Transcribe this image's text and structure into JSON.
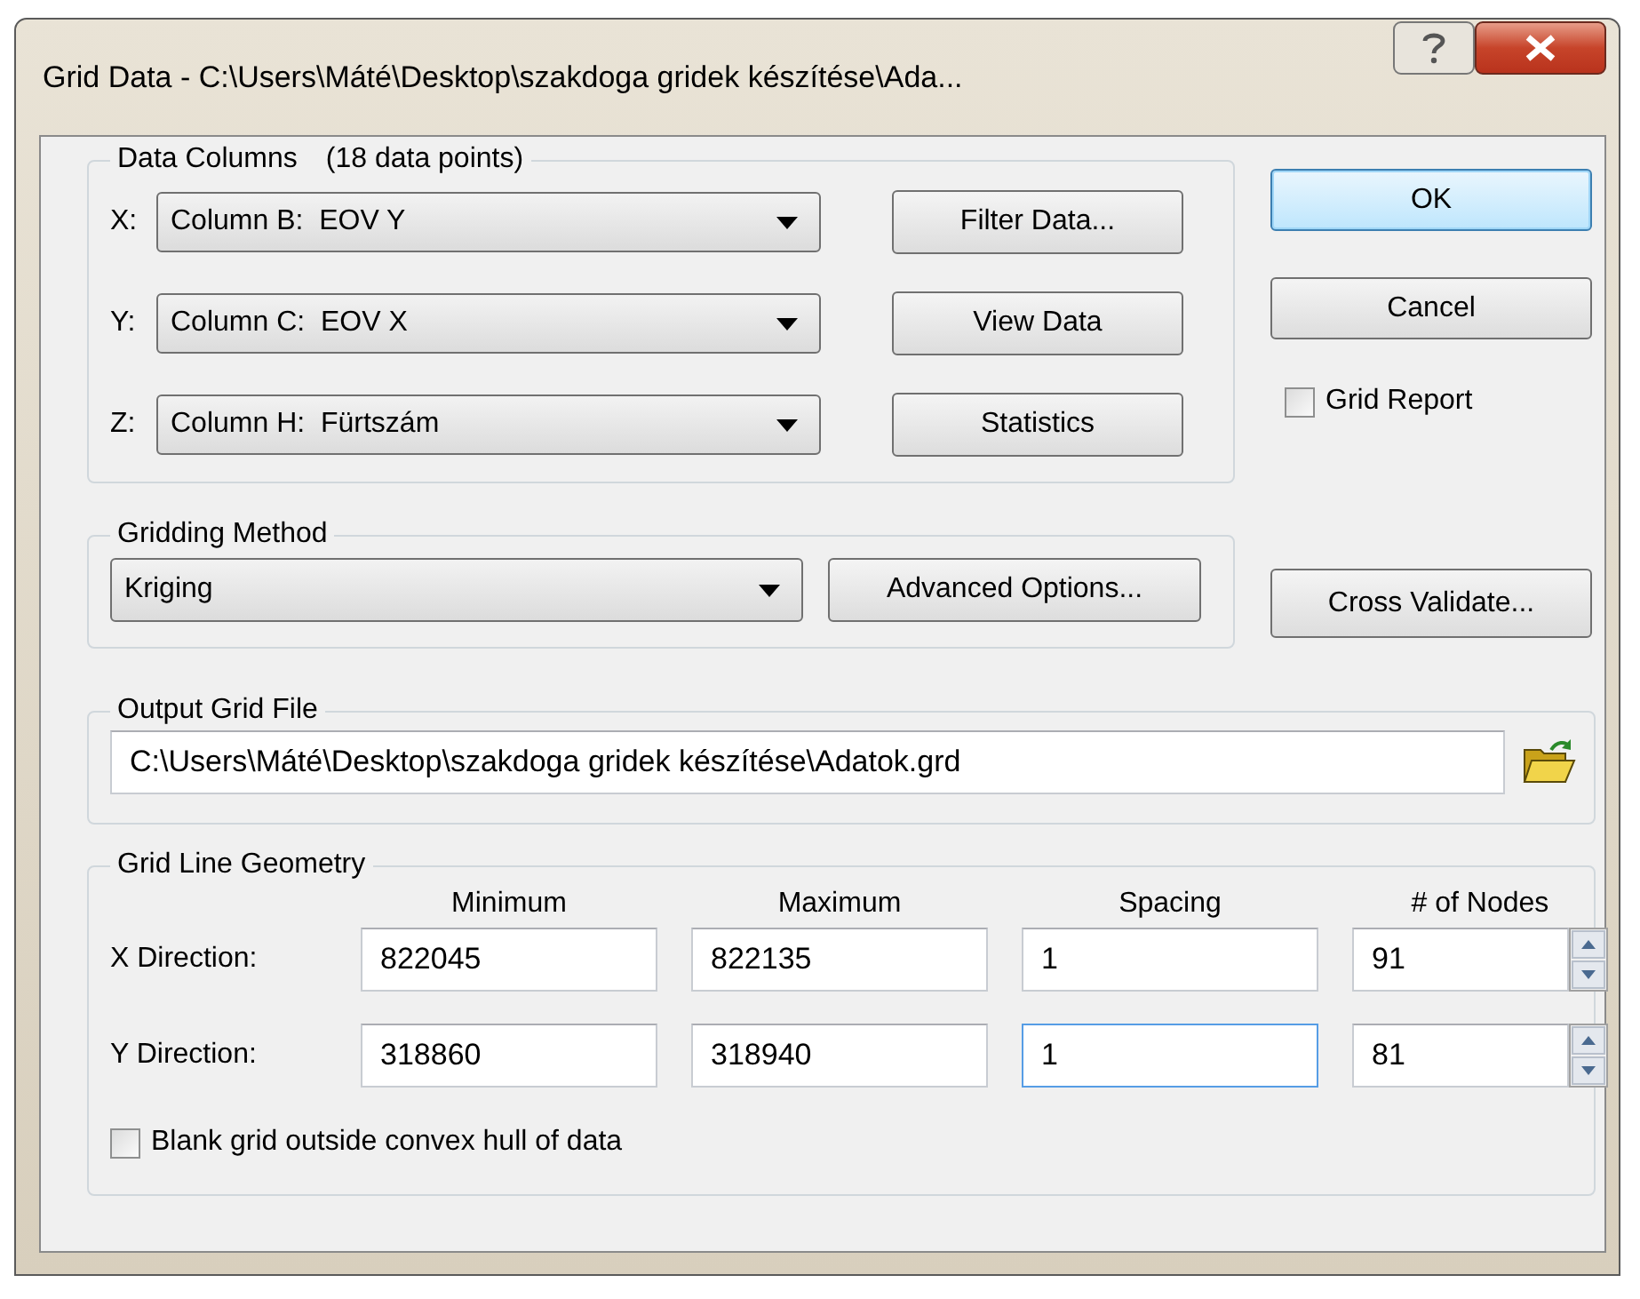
{
  "window": {
    "title": "Grid Data - C:\\Users\\Máté\\Desktop\\szakdoga gridek készítése\\Ada..."
  },
  "data_columns": {
    "title": "Data Columns",
    "count": "(18 data points)",
    "selectors": [
      {
        "label": "X:",
        "value": "Column B:  EOV Y"
      },
      {
        "label": "Y:",
        "value": "Column C:  EOV X"
      },
      {
        "label": "Z:",
        "value": "Column H:  Fürtszám"
      }
    ],
    "buttons": [
      "Filter Data...",
      "View Data",
      "Statistics"
    ]
  },
  "dialog_buttons": [
    {
      "label": "OK",
      "default": true
    },
    {
      "label": "Cancel",
      "default": false
    }
  ],
  "grid_report": {
    "label": "Grid Report",
    "checked": false
  },
  "gridding_method": {
    "title": "Gridding Method",
    "value": "Kriging",
    "button": "Advanced Options..."
  },
  "cross_validate": {
    "label": "Cross Validate..."
  },
  "output_grid_file": {
    "title": "Output Grid File",
    "value": "C:\\Users\\Máté\\Desktop\\szakdoga gridek készítése\\Adatok.grd"
  },
  "grid_line_geometry": {
    "title": "Grid Line Geometry",
    "columns": [
      "Minimum",
      "Maximum",
      "Spacing",
      "# of Nodes"
    ],
    "rows": [
      {
        "label": "X Direction:",
        "cells": [
          {
            "value": "822045",
            "focused": false
          },
          {
            "value": "822135",
            "focused": false
          },
          {
            "value": "1",
            "focused": false
          },
          {
            "value": "91",
            "focused": false
          }
        ]
      },
      {
        "label": "Y Direction:",
        "cells": [
          {
            "value": "318860",
            "focused": false
          },
          {
            "value": "318940",
            "focused": false
          },
          {
            "value": "1",
            "focused": true
          },
          {
            "value": "81",
            "focused": false
          }
        ]
      }
    ],
    "blank_hull": {
      "label": "Blank grid outside convex hull of data",
      "checked": false
    }
  }
}
